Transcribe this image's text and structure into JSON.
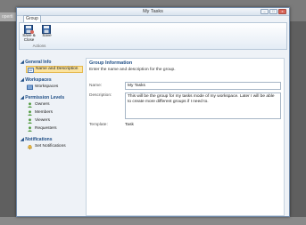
{
  "background": {
    "left_text": "operti"
  },
  "window": {
    "title": "My Tasks",
    "minimize_label": "–",
    "maximize_label": "□",
    "close_label": "x"
  },
  "ribbon": {
    "tab_label": "Group",
    "save_close_line1": "Save &",
    "save_close_line2": "Close",
    "save_label": "Save",
    "group_label": "Actions"
  },
  "nav": {
    "general_info_header": "General Info",
    "name_description": "Name and Description",
    "workspaces_header": "Workspaces",
    "workspaces_item": "Workspaces",
    "permission_header": "Permission Levels",
    "owners": "Owners",
    "members": "Members",
    "viewers": "Viewers",
    "requesters": "Requesters",
    "notifications_header": "Notifications",
    "set_notifications": "Set Notifications"
  },
  "panel": {
    "title": "Group Information",
    "subtitle": "Enter the name and description for the group.",
    "name_label": "Name:",
    "name_value": "My Tasks",
    "description_label": "Description:",
    "description_value": "This will be the group for my tasks mode of my workspace. Later I will be able to create more different groups if I need to.",
    "template_label": "Template:",
    "template_value": "Task"
  },
  "colors": {
    "accent": "#1f4e86",
    "selected": "#fbe39f",
    "close": "#d9665a"
  }
}
